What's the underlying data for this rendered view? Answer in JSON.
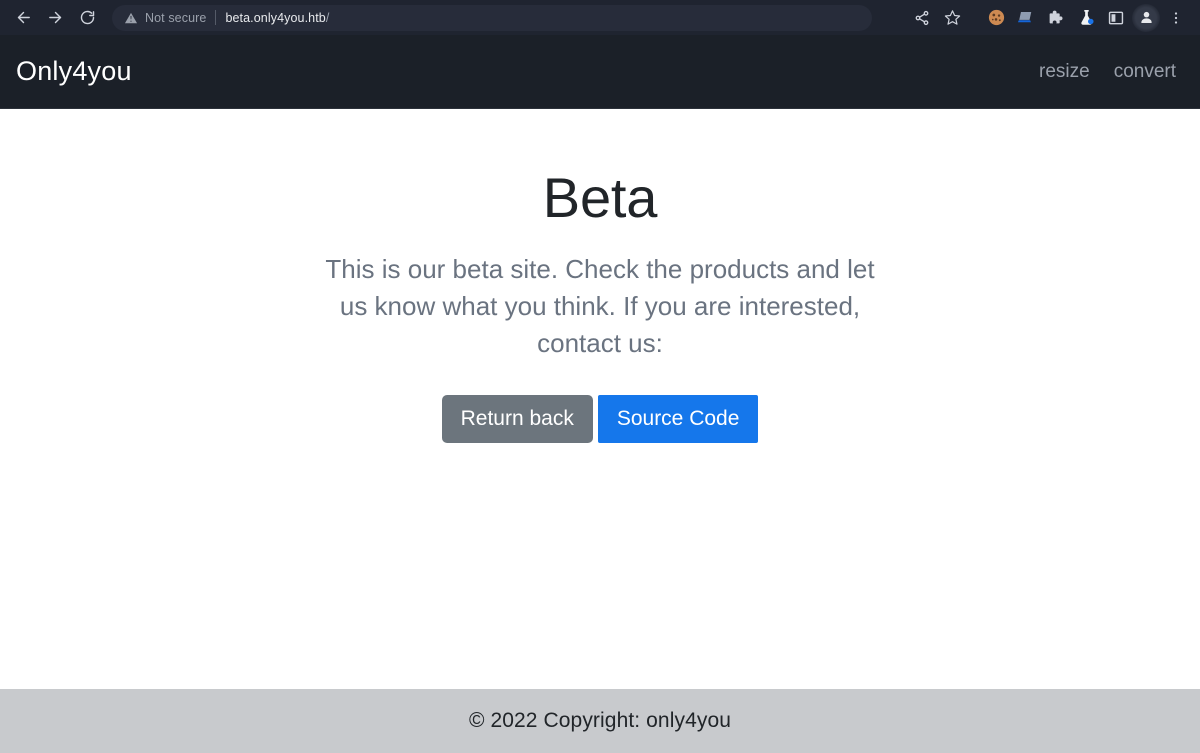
{
  "browser": {
    "back_icon": "arrow-left-icon",
    "forward_icon": "arrow-right-icon",
    "reload_icon": "reload-icon",
    "security_label": "Not secure",
    "security_icon": "warning-triangle-icon",
    "url": "beta.only4you.htb",
    "url_path": "/",
    "toolbar_icons": [
      {
        "name": "share-icon",
        "label": "Share"
      },
      {
        "name": "bookmark-star-icon",
        "label": "Bookmark this tab"
      },
      {
        "name": "cookie-icon",
        "label": "Cookie editor"
      },
      {
        "name": "notebook-icon",
        "label": "Notebook"
      },
      {
        "name": "puzzle-extensions-icon",
        "label": "Extensions"
      },
      {
        "name": "flask-icon",
        "label": "Lab"
      },
      {
        "name": "side-panel-icon",
        "label": "Side panel"
      },
      {
        "name": "profile-avatar-icon",
        "label": "Profile"
      },
      {
        "name": "three-dot-menu-icon",
        "label": "Customize and control"
      }
    ]
  },
  "site": {
    "brand": "Only4you",
    "nav_links": [
      {
        "label": "resize"
      },
      {
        "label": "convert"
      }
    ]
  },
  "main": {
    "title": "Beta",
    "description": "This is our beta site. Check the products and let us know what you think. If you are interested, contact us:",
    "buttons": [
      {
        "label": "Return back",
        "style": "secondary"
      },
      {
        "label": "Source Code",
        "style": "primary"
      }
    ]
  },
  "footer": {
    "copyright": "© 2022 Copyright: only4you"
  },
  "colors": {
    "chrome_bg": "#1f2430",
    "navbar_bg": "#1b2028",
    "primary_button": "#1577eb",
    "secondary_button": "#6c757d",
    "footer_bg": "#c8cacd",
    "body_text": "#6a7380"
  }
}
